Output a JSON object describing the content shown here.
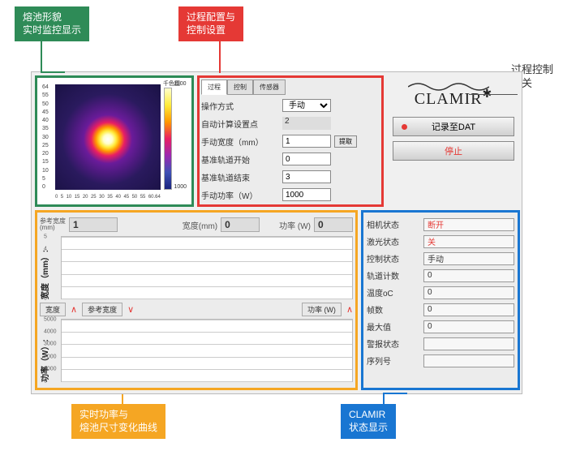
{
  "callouts": {
    "green": "熔池形貌\n实时监控显示",
    "red": "过程配置与\n控制设置",
    "yellow": "实时功率与\n熔池尺寸变化曲线",
    "blue": "CLAMIR\n状态显示",
    "right": "过程控制\n开关"
  },
  "thermal": {
    "title": "千色图",
    "y_ticks": [
      "64",
      "55",
      "50",
      "45",
      "40",
      "35",
      "30",
      "25",
      "20",
      "15",
      "10",
      "5",
      "0"
    ],
    "x_ticks": [
      "0",
      "5",
      "10",
      "15",
      "20",
      "25",
      "30",
      "35",
      "40",
      "45",
      "50",
      "55",
      "60.64"
    ],
    "cbar_top": "1100",
    "cbar_bot": "1000"
  },
  "config": {
    "tabs": [
      "过程",
      "控制",
      "传感器"
    ],
    "rows": {
      "mode_label": "操作方式",
      "mode_value": "手动",
      "auto_label": "自动计算设置点",
      "auto_value": "2",
      "width_label": "手动宽度（mm）",
      "width_value": "1",
      "width_btn": "提取",
      "base_start_label": "基准轨道开始",
      "base_start_value": "0",
      "base_end_label": "基准轨道结束",
      "base_end_value": "3",
      "power_label": "手动功率（W）",
      "power_value": "1000"
    }
  },
  "logo": {
    "text": "CLAMIR"
  },
  "controls": {
    "record": "记录至DAT",
    "stop": "停止"
  },
  "readout": {
    "ref_label": "参考宽度\n(mm)",
    "ref_value": "1",
    "width_label": "宽度(mm)",
    "width_value": "0",
    "power_label": "功率 (W)",
    "power_value": "0"
  },
  "charts": {
    "top_axis_label": "宽度（mm）:",
    "bot_axis_label": "功率（W）:",
    "mid": {
      "w": "宽度",
      "ref": "参考宽度",
      "p": "功率 (W)"
    }
  },
  "status": {
    "rows": [
      {
        "label": "相机状态",
        "value": "断开",
        "danger": true
      },
      {
        "label": "激光状态",
        "value": "关",
        "danger": true
      },
      {
        "label": "控制状态",
        "value": "手动",
        "danger": false
      },
      {
        "label": "轨道计数",
        "value": "0",
        "danger": false
      },
      {
        "label": "温度oC",
        "value": "0",
        "danger": false
      },
      {
        "label": "帧数",
        "value": "0",
        "danger": false
      },
      {
        "label": "最大值",
        "value": "0",
        "danger": false
      },
      {
        "label": "警报状态",
        "value": "",
        "danger": false
      },
      {
        "label": "序列号",
        "value": "",
        "danger": false
      }
    ]
  },
  "chart_data": [
    {
      "type": "line",
      "title": "宽度(mm)",
      "xlabel": "",
      "ylabel": "宽度（mm）",
      "ylim": [
        0,
        5
      ],
      "y_ticks": [
        0,
        1,
        2,
        3,
        4,
        5
      ],
      "series": [
        {
          "name": "宽度",
          "values": []
        },
        {
          "name": "参考宽度",
          "values": []
        }
      ]
    },
    {
      "type": "line",
      "title": "功率(W)",
      "xlabel": "",
      "ylabel": "功率（W）",
      "ylim": [
        0,
        5000
      ],
      "y_ticks": [
        0,
        1000,
        2000,
        3000,
        4000,
        5000
      ],
      "series": [
        {
          "name": "功率 (W)",
          "values": []
        }
      ]
    }
  ]
}
